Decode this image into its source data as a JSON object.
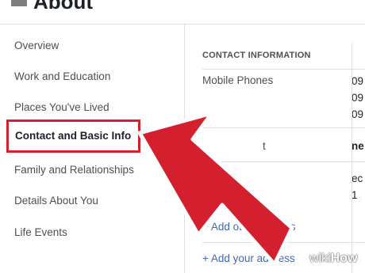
{
  "header": {
    "title": "About"
  },
  "sidebar": {
    "items": [
      {
        "label": "Overview"
      },
      {
        "label": "Work and Education"
      },
      {
        "label": "Places You've Lived"
      },
      {
        "label": "Contact and Basic Info"
      },
      {
        "label": "Family and Relationships"
      },
      {
        "label": "Details About You"
      },
      {
        "label": "Life Events"
      }
    ],
    "selected_index": 3
  },
  "contact": {
    "section_title": "CONTACT INFORMATION",
    "mobile_label": "Mobile Phones",
    "phone_values": [
      "09",
      "09",
      "09"
    ],
    "partial_label": "t",
    "partial_value": "ne",
    "partial_value_2": "ec",
    "partial_value_3": "1",
    "add_phones": "+ Add other phones",
    "add_address": "+ Add your address"
  },
  "watermark": {
    "wiki": "wiki",
    "how": "How"
  },
  "colors": {
    "highlight_red": "#d4202e",
    "link_blue": "#4267b2"
  }
}
